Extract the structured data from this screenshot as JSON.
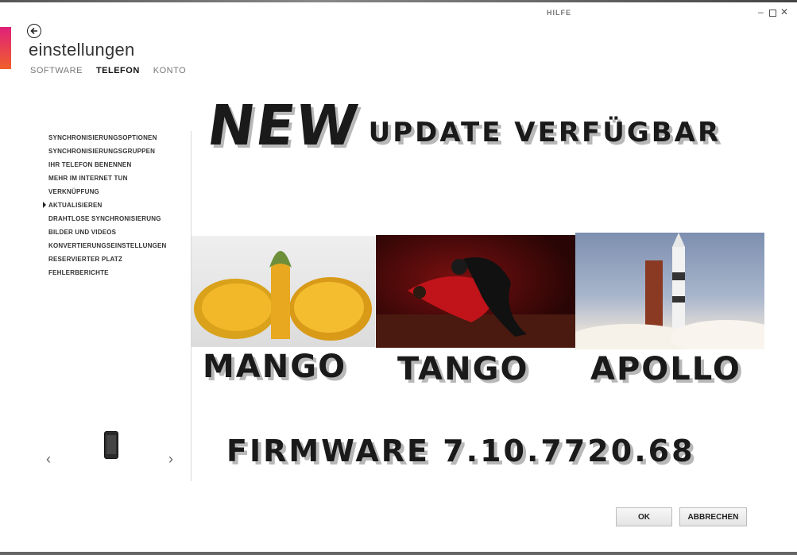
{
  "window": {
    "help_label": "HILFE",
    "minimize_glyph": "–",
    "close_glyph": "✕"
  },
  "header": {
    "title": "einstellungen",
    "tabs": [
      {
        "label": "SOFTWARE",
        "active": false
      },
      {
        "label": "TELEFON",
        "active": true
      },
      {
        "label": "KONTO",
        "active": false
      }
    ]
  },
  "sidebar": {
    "items": [
      {
        "label": "SYNCHRONISIERUNGSOPTIONEN"
      },
      {
        "label": "SYNCHRONISIERUNGSGRUPPEN"
      },
      {
        "label": "IHR TELEFON BENENNEN"
      },
      {
        "label": "MEHR IM INTERNET TUN"
      },
      {
        "label": "VERKNÜPFUNG"
      },
      {
        "label": "AKTUALISIEREN",
        "active": true
      },
      {
        "label": "DRAHTLOSE SYNCHRONISIERUNG"
      },
      {
        "label": "BILDER UND VIDEOS"
      },
      {
        "label": "KONVERTIERUNGSEINSTELLUNGEN"
      },
      {
        "label": "RESERVIERTER PLATZ"
      },
      {
        "label": "FEHLERBERICHTE"
      }
    ],
    "prev_glyph": "‹",
    "next_glyph": "›"
  },
  "promo": {
    "new": "NEW",
    "headline": "UPDATE VERFÜGBAR",
    "captions": {
      "mango": "MANGO",
      "tango": "TANGO",
      "apollo": "APOLLO"
    },
    "firmware": "FIRMWARE 7.10.7720.68"
  },
  "footer": {
    "ok_label": "OK",
    "cancel_label": "ABBRECHEN"
  },
  "colors": {
    "accent_top": "#e0207a",
    "accent_bottom": "#f0602a"
  }
}
